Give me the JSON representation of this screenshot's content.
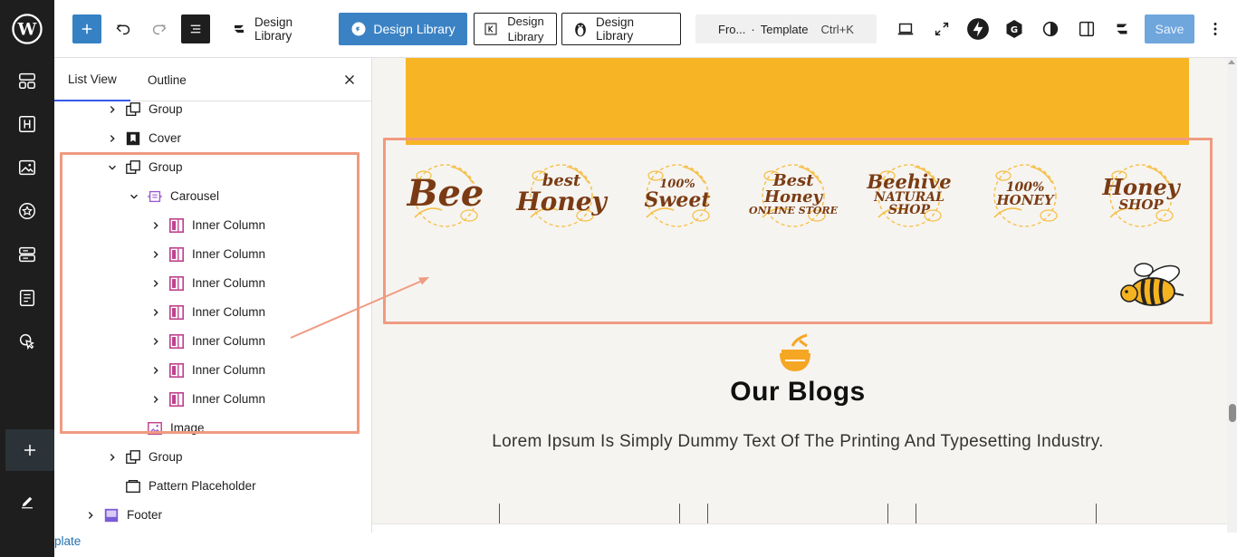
{
  "toolbar": {
    "library_buttons": [
      {
        "label": "Design Library"
      },
      {
        "label": "Design Library"
      },
      {
        "label": "Design Library"
      },
      {
        "label": "Design Library"
      }
    ],
    "command": {
      "title": "Fro...",
      "separator": "·",
      "context": "Template",
      "shortcut": "Ctrl+K"
    },
    "save_label": "Save"
  },
  "listview": {
    "tabs": [
      {
        "label": "List View"
      },
      {
        "label": "Outline"
      }
    ],
    "items": [
      {
        "label": "Group",
        "icon": "group-icon",
        "expanded": false
      },
      {
        "label": "Cover",
        "icon": "cover-icon",
        "expanded": false
      },
      {
        "label": "Group",
        "icon": "group-icon",
        "expanded": true
      },
      {
        "label": "Carousel",
        "icon": "carousel-icon",
        "expanded": true
      },
      {
        "label": "Inner Column",
        "icon": "column-icon",
        "expanded": false
      },
      {
        "label": "Inner Column",
        "icon": "column-icon",
        "expanded": false
      },
      {
        "label": "Inner Column",
        "icon": "column-icon",
        "expanded": false
      },
      {
        "label": "Inner Column",
        "icon": "column-icon",
        "expanded": false
      },
      {
        "label": "Inner Column",
        "icon": "column-icon",
        "expanded": false
      },
      {
        "label": "Inner Column",
        "icon": "column-icon",
        "expanded": false
      },
      {
        "label": "Inner Column",
        "icon": "column-icon",
        "expanded": false
      },
      {
        "label": "Image",
        "icon": "image-icon",
        "expanded": false
      },
      {
        "label": "Group",
        "icon": "group-icon",
        "expanded": false
      },
      {
        "label": "Pattern Placeholder",
        "icon": "placeholder-icon",
        "expanded": false
      },
      {
        "label": "Footer",
        "icon": "footer-icon",
        "expanded": false
      }
    ]
  },
  "breadcrumb": {
    "label": "plate"
  },
  "canvas": {
    "logos": [
      {
        "name": "bee",
        "line1": "Bee",
        "line2": ""
      },
      {
        "name": "best-honey",
        "line1": "best",
        "line2": "Honey"
      },
      {
        "name": "sweet",
        "line1": "100%",
        "line2": "Sweet"
      },
      {
        "name": "best-honey-online",
        "line1": "Best Honey",
        "line2": "ONLINE STORE"
      },
      {
        "name": "beehive",
        "line1": "Beehive",
        "line2": "NATURAL SHOP"
      },
      {
        "name": "honey-100",
        "line1": "100%",
        "line2": "HONEY"
      },
      {
        "name": "honey-shop",
        "line1": "Honey",
        "line2": "SHOP"
      }
    ],
    "blog_title": "Our Blogs",
    "blog_subtitle": "Lorem Ipsum Is Simply Dummy Text Of The Printing And Typesetting Industry."
  },
  "colors": {
    "accent": "#3858e9",
    "library_blue": "#3b82c4",
    "save": "#6fa6dc",
    "honey_yellow": "#f7b526",
    "highlight": "#ef9b81",
    "logo_brown": "#7a3b14",
    "canvas_bg": "#f6f4f0"
  }
}
